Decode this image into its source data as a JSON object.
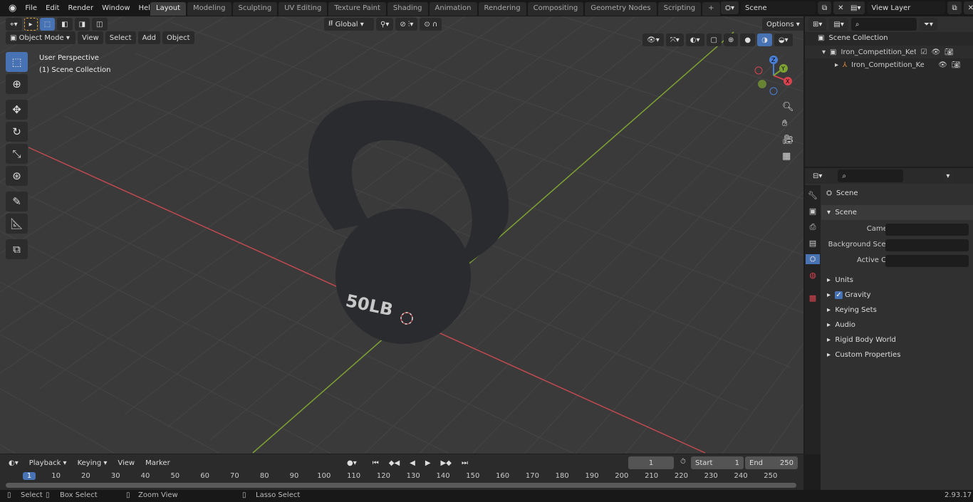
{
  "menu": [
    "File",
    "Edit",
    "Render",
    "Window",
    "Help"
  ],
  "workspaces": [
    "Layout",
    "Modeling",
    "Sculpting",
    "UV Editing",
    "Texture Paint",
    "Shading",
    "Animation",
    "Rendering",
    "Compositing",
    "Geometry Nodes",
    "Scripting"
  ],
  "active_workspace": "Layout",
  "scene_name": "Scene",
  "view_layer": "View Layer",
  "viewport": {
    "mode": "Object Mode",
    "menus": [
      "View",
      "Select",
      "Add",
      "Object"
    ],
    "orientation": "Global",
    "options": "Options",
    "perspective": "User Perspective",
    "collection": "(1) Scene Collection",
    "label_text": "50LB",
    "gizmo": {
      "x": "X",
      "y": "Y",
      "z": "Z"
    }
  },
  "tools": [
    "select-box-icon",
    "cursor-icon",
    "move-icon",
    "rotate-icon",
    "scale-icon",
    "transform-icon",
    "annotate-icon",
    "measure-icon",
    "add-cube-icon"
  ],
  "outliner": {
    "root": "Scene Collection",
    "items": [
      {
        "label": "Iron_Competition_Kettlebell_W"
      },
      {
        "label": "Iron_Competition_Kettlet"
      }
    ]
  },
  "properties": {
    "context": "Scene",
    "section": "Scene",
    "fields": [
      {
        "label": "Camera"
      },
      {
        "label": "Background Scene"
      },
      {
        "label": "Active Clip"
      }
    ],
    "panels": [
      "Units",
      "Gravity",
      "Keying Sets",
      "Audio",
      "Rigid Body World",
      "Custom Properties"
    ],
    "gravity_checked": true
  },
  "timeline": {
    "menus": [
      "Playback",
      "Keying",
      "View",
      "Marker"
    ],
    "current_frame": "1",
    "start_label": "Start",
    "start": "1",
    "end_label": "End",
    "end": "250",
    "ticks": [
      "1",
      "10",
      "20",
      "30",
      "40",
      "50",
      "60",
      "70",
      "80",
      "90",
      "100",
      "110",
      "120",
      "130",
      "140",
      "150",
      "160",
      "170",
      "180",
      "190",
      "200",
      "210",
      "220",
      "230",
      "240",
      "250"
    ]
  },
  "status": {
    "items": [
      "Select",
      "Box Select",
      "Zoom View",
      "Lasso Select"
    ],
    "version": "2.93.17"
  },
  "colors": {
    "accent": "#4772b3",
    "x_axis": "#c14a50",
    "y_axis": "#7ea232",
    "kettlebell": "#2a2b2e"
  }
}
